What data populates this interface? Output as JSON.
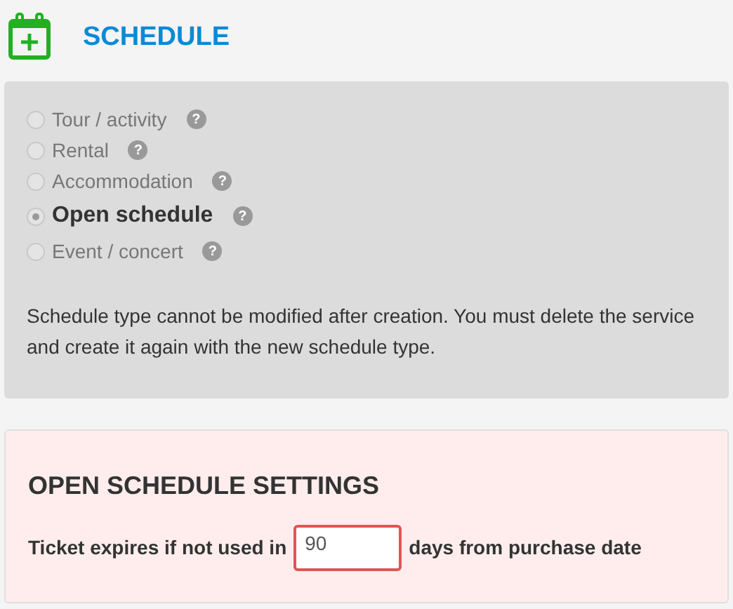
{
  "header": {
    "title": "SCHEDULE"
  },
  "schedule_types": [
    {
      "label": "Tour / activity",
      "selected": false
    },
    {
      "label": "Rental",
      "selected": false
    },
    {
      "label": "Accommodation",
      "selected": false
    },
    {
      "label": "Open schedule",
      "selected": true
    },
    {
      "label": "Event / concert",
      "selected": false
    }
  ],
  "help_mark": "?",
  "note": "Schedule type cannot be modified after creation. You must delete the service and create it again with the new schedule type.",
  "settings": {
    "title": "OPEN SCHEDULE SETTINGS",
    "label_before": "Ticket expires if not used in",
    "days_value": "90",
    "label_after": "days from purchase date"
  }
}
